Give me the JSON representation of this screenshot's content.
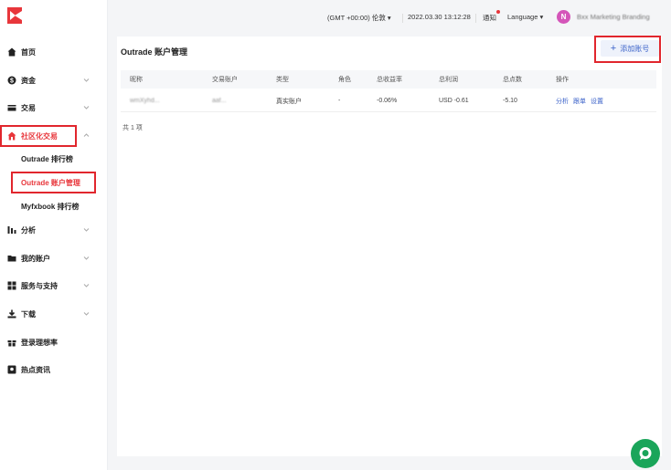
{
  "sidebar": {
    "items": [
      {
        "label": "首页",
        "icon": "home-icon"
      },
      {
        "label": "资金",
        "icon": "funds-icon"
      },
      {
        "label": "交易",
        "icon": "card-icon"
      },
      {
        "label": "社区化交易",
        "icon": "community-icon",
        "active": true
      },
      {
        "label": "分析",
        "icon": "bar-chart-icon"
      },
      {
        "label": "我的账户",
        "icon": "folder-icon"
      },
      {
        "label": "服务与支持",
        "icon": "grid-icon"
      },
      {
        "label": "下载",
        "icon": "download-icon"
      },
      {
        "label": "登录理想率",
        "icon": "gift-icon"
      },
      {
        "label": "热点资讯",
        "icon": "news-icon"
      }
    ],
    "sub_items": [
      {
        "label": "Outrade 排行榜"
      },
      {
        "label": "Outrade 账户管理",
        "active": true
      },
      {
        "label": "Myfxbook 排行榜"
      }
    ]
  },
  "header": {
    "timezone": "(GMT +00:00) 伦敦",
    "datetime": "2022.03.30 13:12:28",
    "notify": "通知",
    "language": "Language",
    "avatar_letter": "N",
    "user_name": "Bxx Marketing Branding"
  },
  "page": {
    "title": "Outrade 账户管理",
    "add_button": "添加账号",
    "columns": [
      "昵称",
      "交易账户",
      "类型",
      "角色",
      "总收益率",
      "总利润",
      "总点数",
      "操作"
    ],
    "rows": [
      {
        "nickname": "wmXyhd...",
        "account": "aaf...",
        "type": "真实账户",
        "role": "-",
        "return_rate": "-0.06%",
        "profit": "USD -0.61",
        "points": "-5.10",
        "actions": [
          "分析",
          "跟单",
          "设置"
        ]
      }
    ],
    "total": "共 1 项"
  },
  "colors": {
    "accent": "#e8363b",
    "link": "#3b62c9",
    "chat": "#1aa55a"
  }
}
